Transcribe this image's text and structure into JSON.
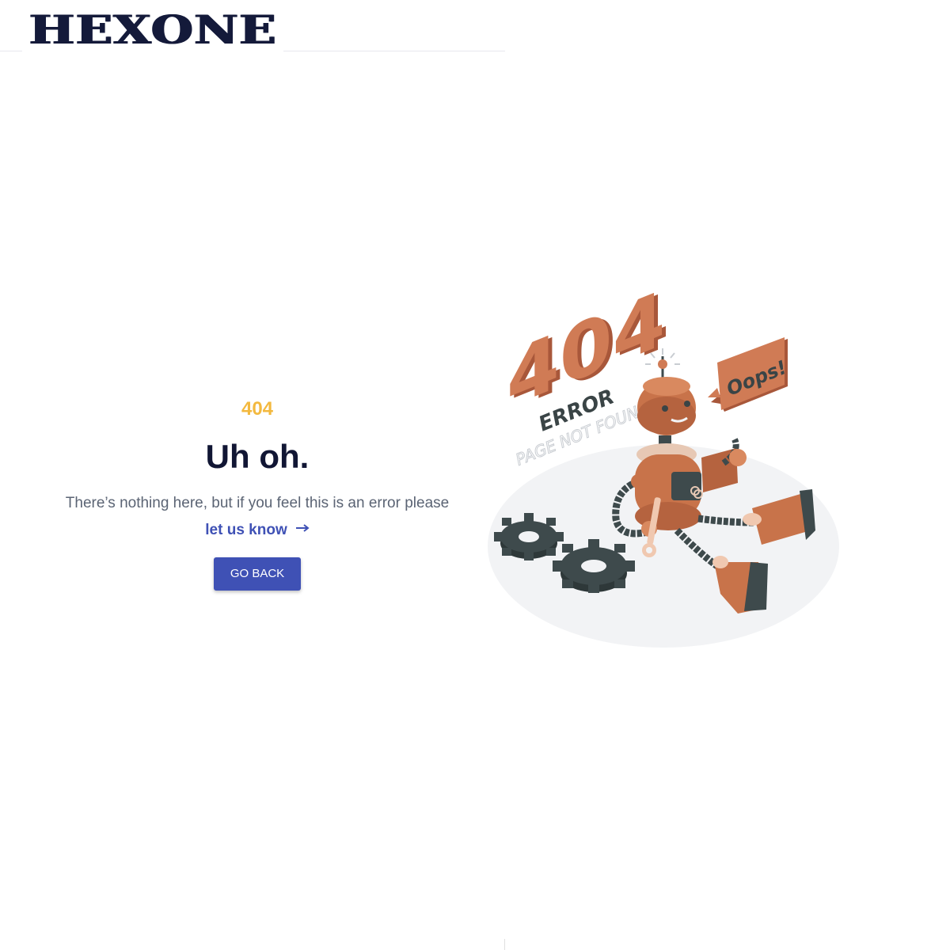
{
  "header": {
    "logo_text": "HEXONE"
  },
  "error": {
    "code": "404",
    "title": "Uh oh.",
    "description": "There’s nothing here, but if you feel this is an error please",
    "link_label": "let us know",
    "button_label": "GO BACK"
  },
  "illustration": {
    "big_text": "404",
    "error_text": "ERROR",
    "subtitle_text": "PAGE NOT FOUND",
    "bubble_text": "Oops!"
  },
  "colors": {
    "accent": "#3f51b5",
    "code": "#f3b93f",
    "title": "#111634",
    "text": "#5b6474",
    "robot": "#c8734a",
    "gear": "#3e4a4c"
  }
}
